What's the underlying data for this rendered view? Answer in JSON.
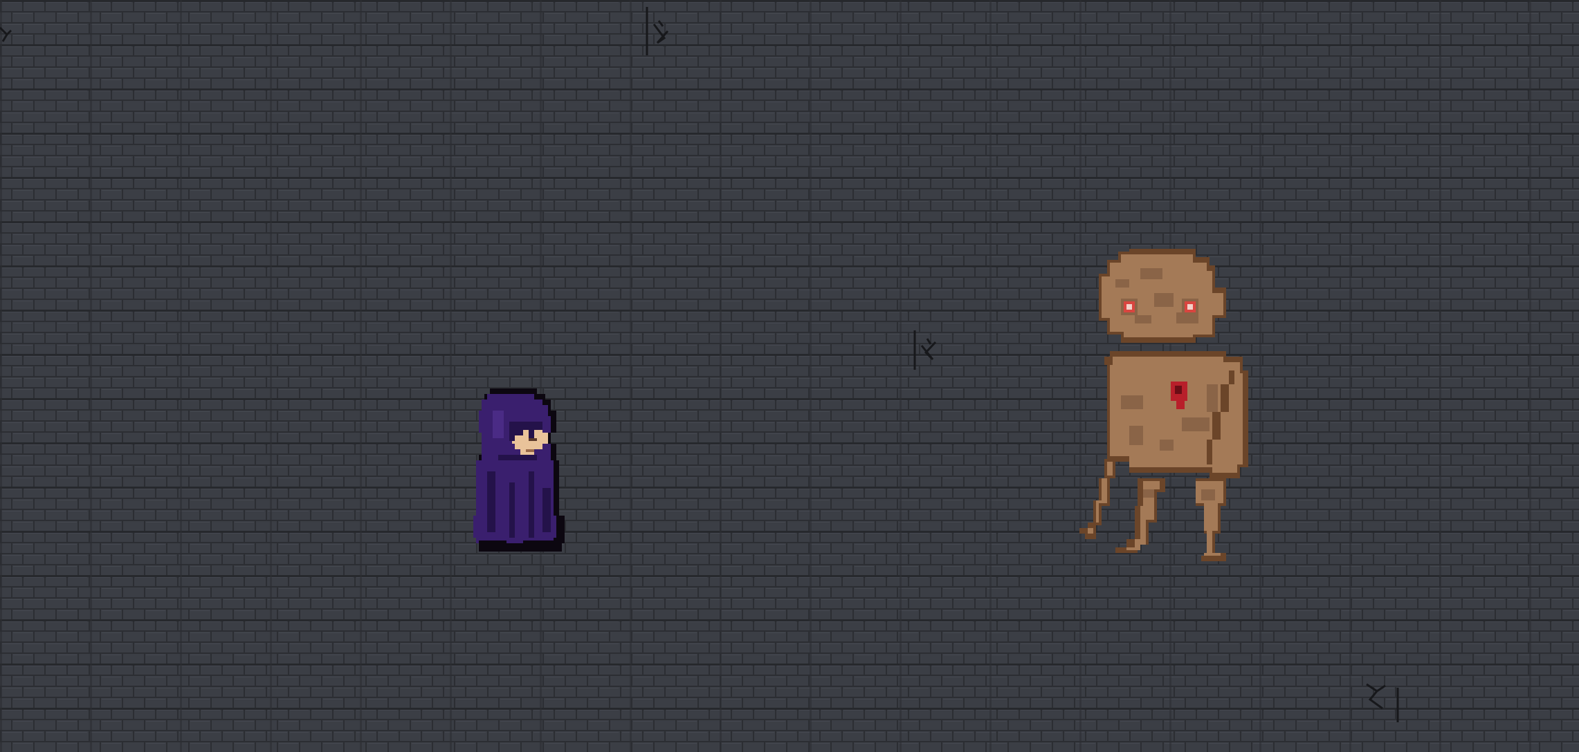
{
  "scene": {
    "type": "top-down dungeon room",
    "floor": {
      "pattern": "stone-brick-tiles",
      "base_color": "#3b3e45",
      "mortar_color": "#2a2c31",
      "highlight_color": "#474a52",
      "crack_color": "#17181b"
    },
    "cracks": [
      {
        "name": "crack-top-left"
      },
      {
        "name": "crack-top-center"
      },
      {
        "name": "crack-middle"
      },
      {
        "name": "crack-bottom-right"
      }
    ]
  },
  "player": {
    "name": "hooded-figure",
    "cloak_color": "#3a1f6e",
    "cloak_shadow": "#24124a",
    "skin_color": "#e9c39a",
    "outline_color": "#0c0710"
  },
  "enemy": {
    "name": "clay-golem",
    "body_color": "#a47a57",
    "dark_patch_color": "#8a6447",
    "outline_color": "#6b4529",
    "eye_color": "#d9453f",
    "wound_color": "#b81f2a"
  }
}
